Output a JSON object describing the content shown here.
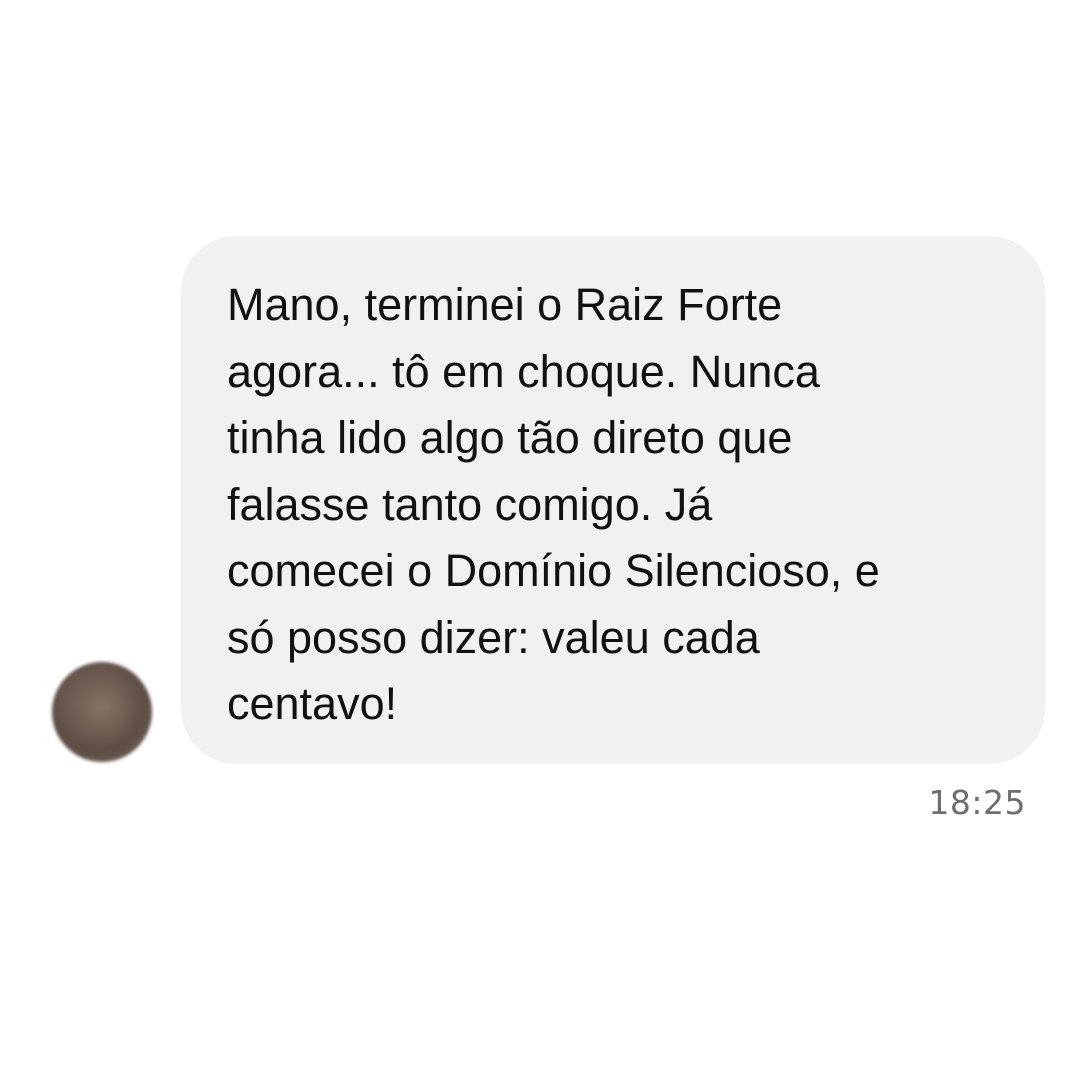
{
  "conversation": {
    "messages": [
      {
        "text": "Mano, terminei o Raiz Forte\nagora... tô em choque. Nunca\ntinha lido algo tão direto que\nfalasse tanto comigo. Já\ncomecei o Domínio Silencioso, e\nsó posso dizer: valeu cada\ncentavo!",
        "time": "18:25",
        "avatar": "blurred-profile-photo"
      }
    ]
  },
  "colors": {
    "background": "#ffffff",
    "bubble": "#f1f1f2",
    "text": "#111111",
    "timestamp": "#6f6f6f"
  }
}
